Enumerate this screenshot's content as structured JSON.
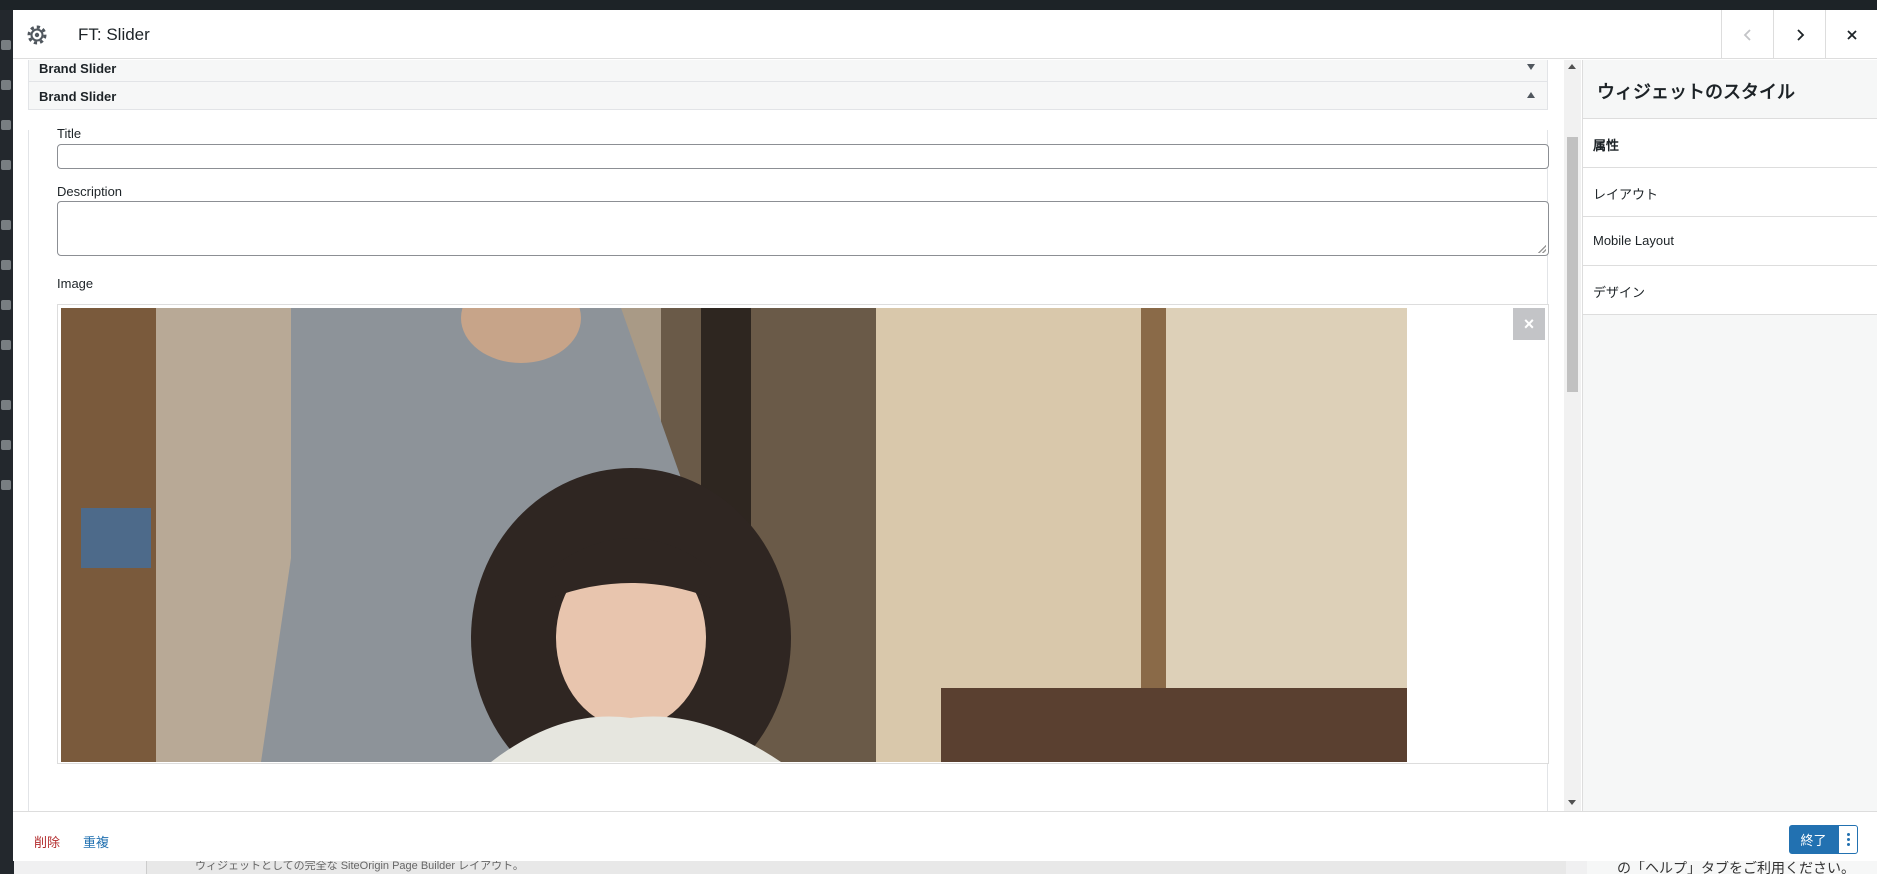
{
  "modal": {
    "title": "FT: Slider",
    "icon": "gear-icon"
  },
  "sections": {
    "collapsed_label": "Brand Slider",
    "expanded_label": "Brand Slider"
  },
  "form": {
    "title_label": "Title",
    "title_value": "",
    "description_label": "Description",
    "description_value": "",
    "image_label": "Image",
    "image_remove": "×"
  },
  "sidebar": {
    "title": "ウィジェットのスタイル",
    "items": [
      {
        "label": "属性"
      },
      {
        "label": "レイアウト"
      },
      {
        "label": "Mobile Layout"
      },
      {
        "label": "デザイン"
      }
    ]
  },
  "footer": {
    "delete_label": "削除",
    "duplicate_label": "重複",
    "done_label": "終了"
  },
  "background": {
    "footer_text": "ウィジェットとしての完全な SiteOrigin Page Builder レイアウト。",
    "help_text": "の「ヘルプ」タブをご利用ください。"
  },
  "colors": {
    "accent": "#2271b1",
    "danger": "#b32d2e"
  }
}
